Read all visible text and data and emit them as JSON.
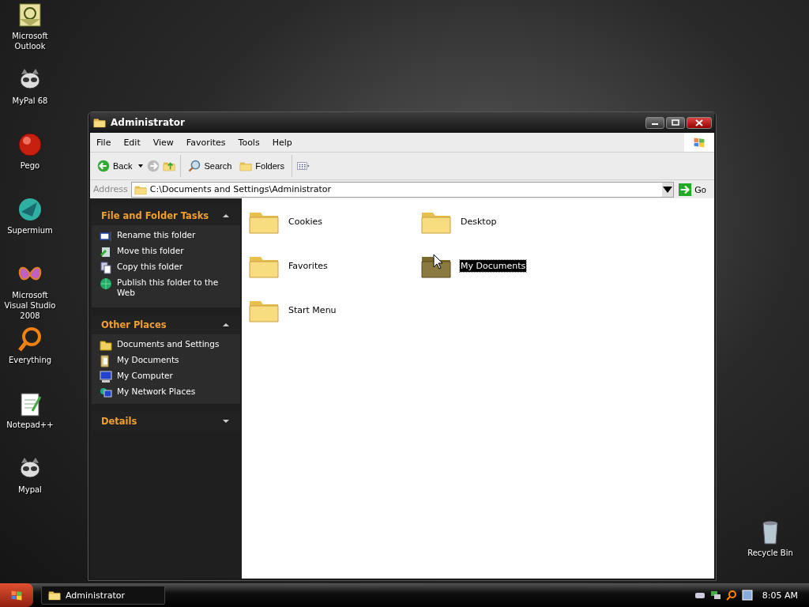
{
  "desktop_icons": [
    {
      "label": "Microsoft Outlook",
      "kind": "mail"
    },
    {
      "label": "MyPal 68",
      "kind": "raccoon"
    },
    {
      "label": "Pego",
      "kind": "orb"
    },
    {
      "label": "Supermium",
      "kind": "globe"
    },
    {
      "label": "Microsoft Visual Studio 2008",
      "kind": "butterfly"
    },
    {
      "label": "Everything",
      "kind": "magnifier"
    },
    {
      "label": "Notepad++",
      "kind": "notepad"
    },
    {
      "label": "Mypal",
      "kind": "raccoon"
    }
  ],
  "recycle_bin": {
    "label": "Recycle Bin"
  },
  "window": {
    "title": "Administrator",
    "menu": [
      "File",
      "Edit",
      "View",
      "Favorites",
      "Tools",
      "Help"
    ],
    "toolbar": {
      "back": "Back",
      "search": "Search",
      "folders": "Folders"
    },
    "address": {
      "label": "Address",
      "value": "C:\\Documents and Settings\\Administrator",
      "go": "Go"
    },
    "sidebar": [
      {
        "title": "File and Folder Tasks",
        "expanded": true,
        "items": [
          {
            "label": "Rename this folder",
            "kind": "rename"
          },
          {
            "label": "Move this folder",
            "kind": "move"
          },
          {
            "label": "Copy this folder",
            "kind": "copy"
          },
          {
            "label": "Publish this folder to the Web",
            "kind": "web"
          }
        ]
      },
      {
        "title": "Other Places",
        "expanded": true,
        "items": [
          {
            "label": "Documents and Settings",
            "kind": "folder"
          },
          {
            "label": "My Documents",
            "kind": "documents"
          },
          {
            "label": "My Computer",
            "kind": "computer"
          },
          {
            "label": "My Network Places",
            "kind": "network"
          }
        ]
      },
      {
        "title": "Details",
        "expanded": false
      }
    ],
    "files": [
      {
        "name": "Cookies",
        "selected": false
      },
      {
        "name": "Desktop",
        "selected": false
      },
      {
        "name": "Favorites",
        "selected": false
      },
      {
        "name": "My Documents",
        "selected": true
      },
      {
        "name": "Start Menu",
        "selected": false
      }
    ]
  },
  "taskbar": {
    "tasks": [
      {
        "label": "Administrator"
      }
    ],
    "clock": "8:05 AM"
  }
}
